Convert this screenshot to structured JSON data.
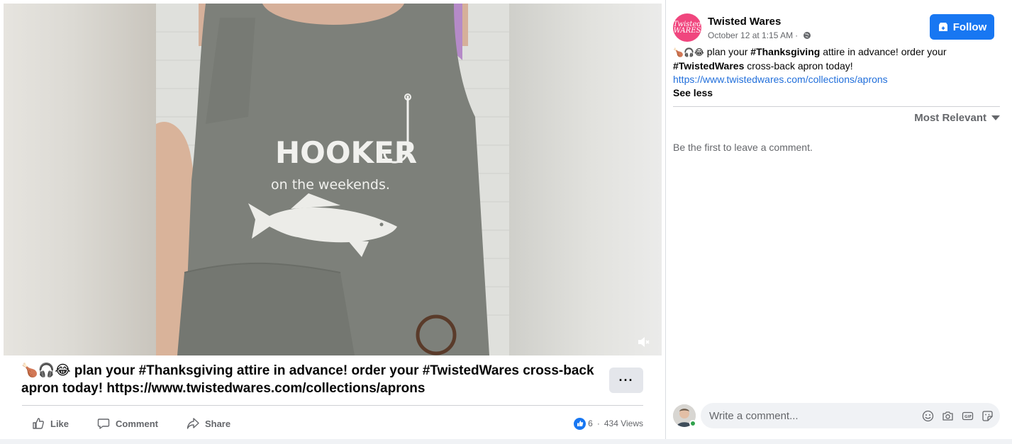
{
  "post": {
    "caption_emojis": "🍗🎧😂",
    "caption_text": " plan your #Thanksgiving attire in advance! order your #TwistedWares cross-back apron today! https://www.twistedwares.com/collections/aprons",
    "more_label": "···",
    "actions": {
      "like": "Like",
      "comment": "Comment",
      "share": "Share"
    },
    "stats": {
      "reactions": "6",
      "separator": "·",
      "views": "434 Views"
    }
  },
  "media": {
    "apron_headline": "HOOKER",
    "apron_subline": "on the weekends.",
    "mute_icon": "volume-muted-icon"
  },
  "sidebar": {
    "page_logo_text": "Twisted WARES",
    "page_name": "Twisted Wares",
    "timestamp": "October 12 at 1:15 AM",
    "meta_separator": "·",
    "follow_label": "Follow",
    "text_emojis": "🍗🎧😂",
    "text_part1": " plan your ",
    "tag1": "#Thanksgiving",
    "text_part2": " attire in advance! order your ",
    "tag2": "#TwistedWares",
    "text_part3": " cross-back apron today!",
    "link": "https://www.twistedwares.com/collections/aprons",
    "see_less": "See less",
    "sort_label": "Most Relevant",
    "empty_comments": "Be the first to leave a comment.",
    "comment_placeholder": "Write a comment..."
  },
  "colors": {
    "brand_blue": "#1877f2",
    "link_blue": "#216fdb",
    "page_pink": "#f0467e",
    "apron_gray": "#7d807a",
    "online_green": "#31a24c"
  }
}
